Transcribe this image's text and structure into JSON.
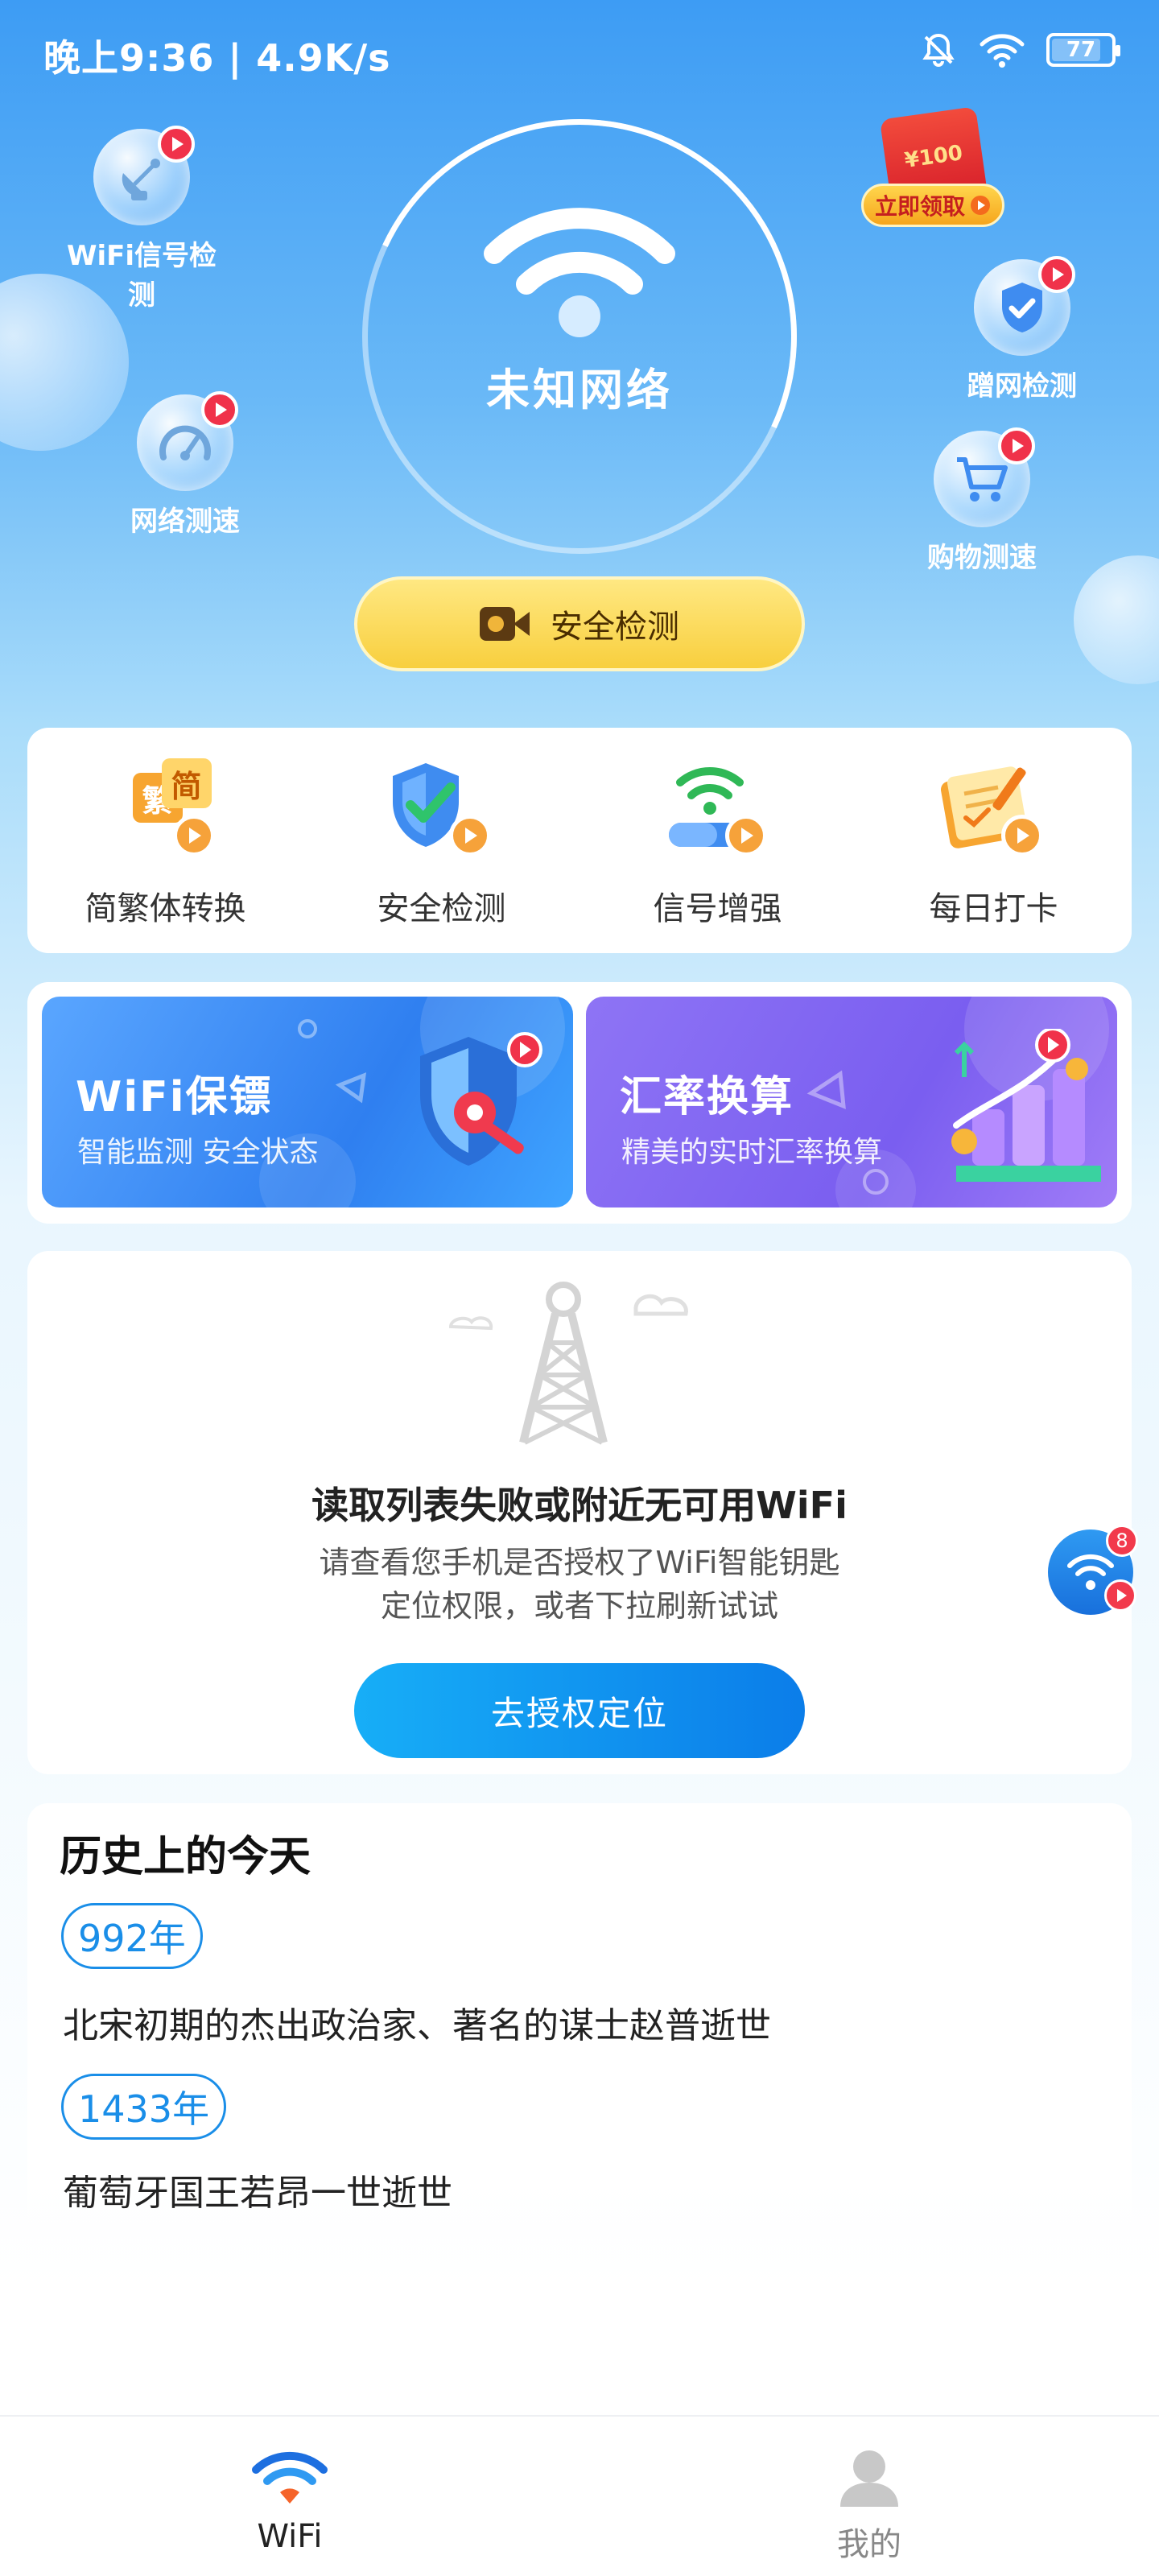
{
  "status_bar": {
    "time": "晚上9:36 | 4.9K/s",
    "battery": "77"
  },
  "hero": {
    "network_label": "未知网络",
    "scan_button": "安全检测"
  },
  "float_items": {
    "signal": "WiFi信号检测",
    "speed": "网络测速",
    "leech": "蹭网检测",
    "shopping": "购物测速",
    "redpacket_amount": "¥100",
    "redpacket_button": "立即领取"
  },
  "tools": [
    {
      "label": "简繁体转换",
      "glyph_top": "简",
      "glyph_bottom": "繁"
    },
    {
      "label": "安全检测"
    },
    {
      "label": "信号增强"
    },
    {
      "label": "每日打卡"
    }
  ],
  "promos": [
    {
      "title": "WiFi保镖",
      "subtitle": "智能监测 安全状态"
    },
    {
      "title": "汇率换算",
      "subtitle": "精美的实时汇率换算"
    }
  ],
  "empty_state": {
    "title": "读取列表失败或附近无可用WiFi",
    "desc_line1": "请查看您手机是否授权了WiFi智能钥匙",
    "desc_line2": "定位权限，或者下拉刷新试试",
    "button": "去授权定位"
  },
  "floating_badge_count": "8",
  "history": {
    "title": "历史上的今天",
    "events": [
      {
        "year": "992年",
        "text": "北宋初期的杰出政治家、著名的谋士赵普逝世"
      },
      {
        "year": "1433年",
        "text": "葡萄牙国王若昂一世逝世"
      }
    ]
  },
  "bottom_nav": {
    "wifi": "WiFi",
    "me": "我的"
  },
  "colors": {
    "accent_blue": "#1a8ee8",
    "scan_yellow": "#f8cf3e",
    "badge_red": "#f0324a"
  }
}
